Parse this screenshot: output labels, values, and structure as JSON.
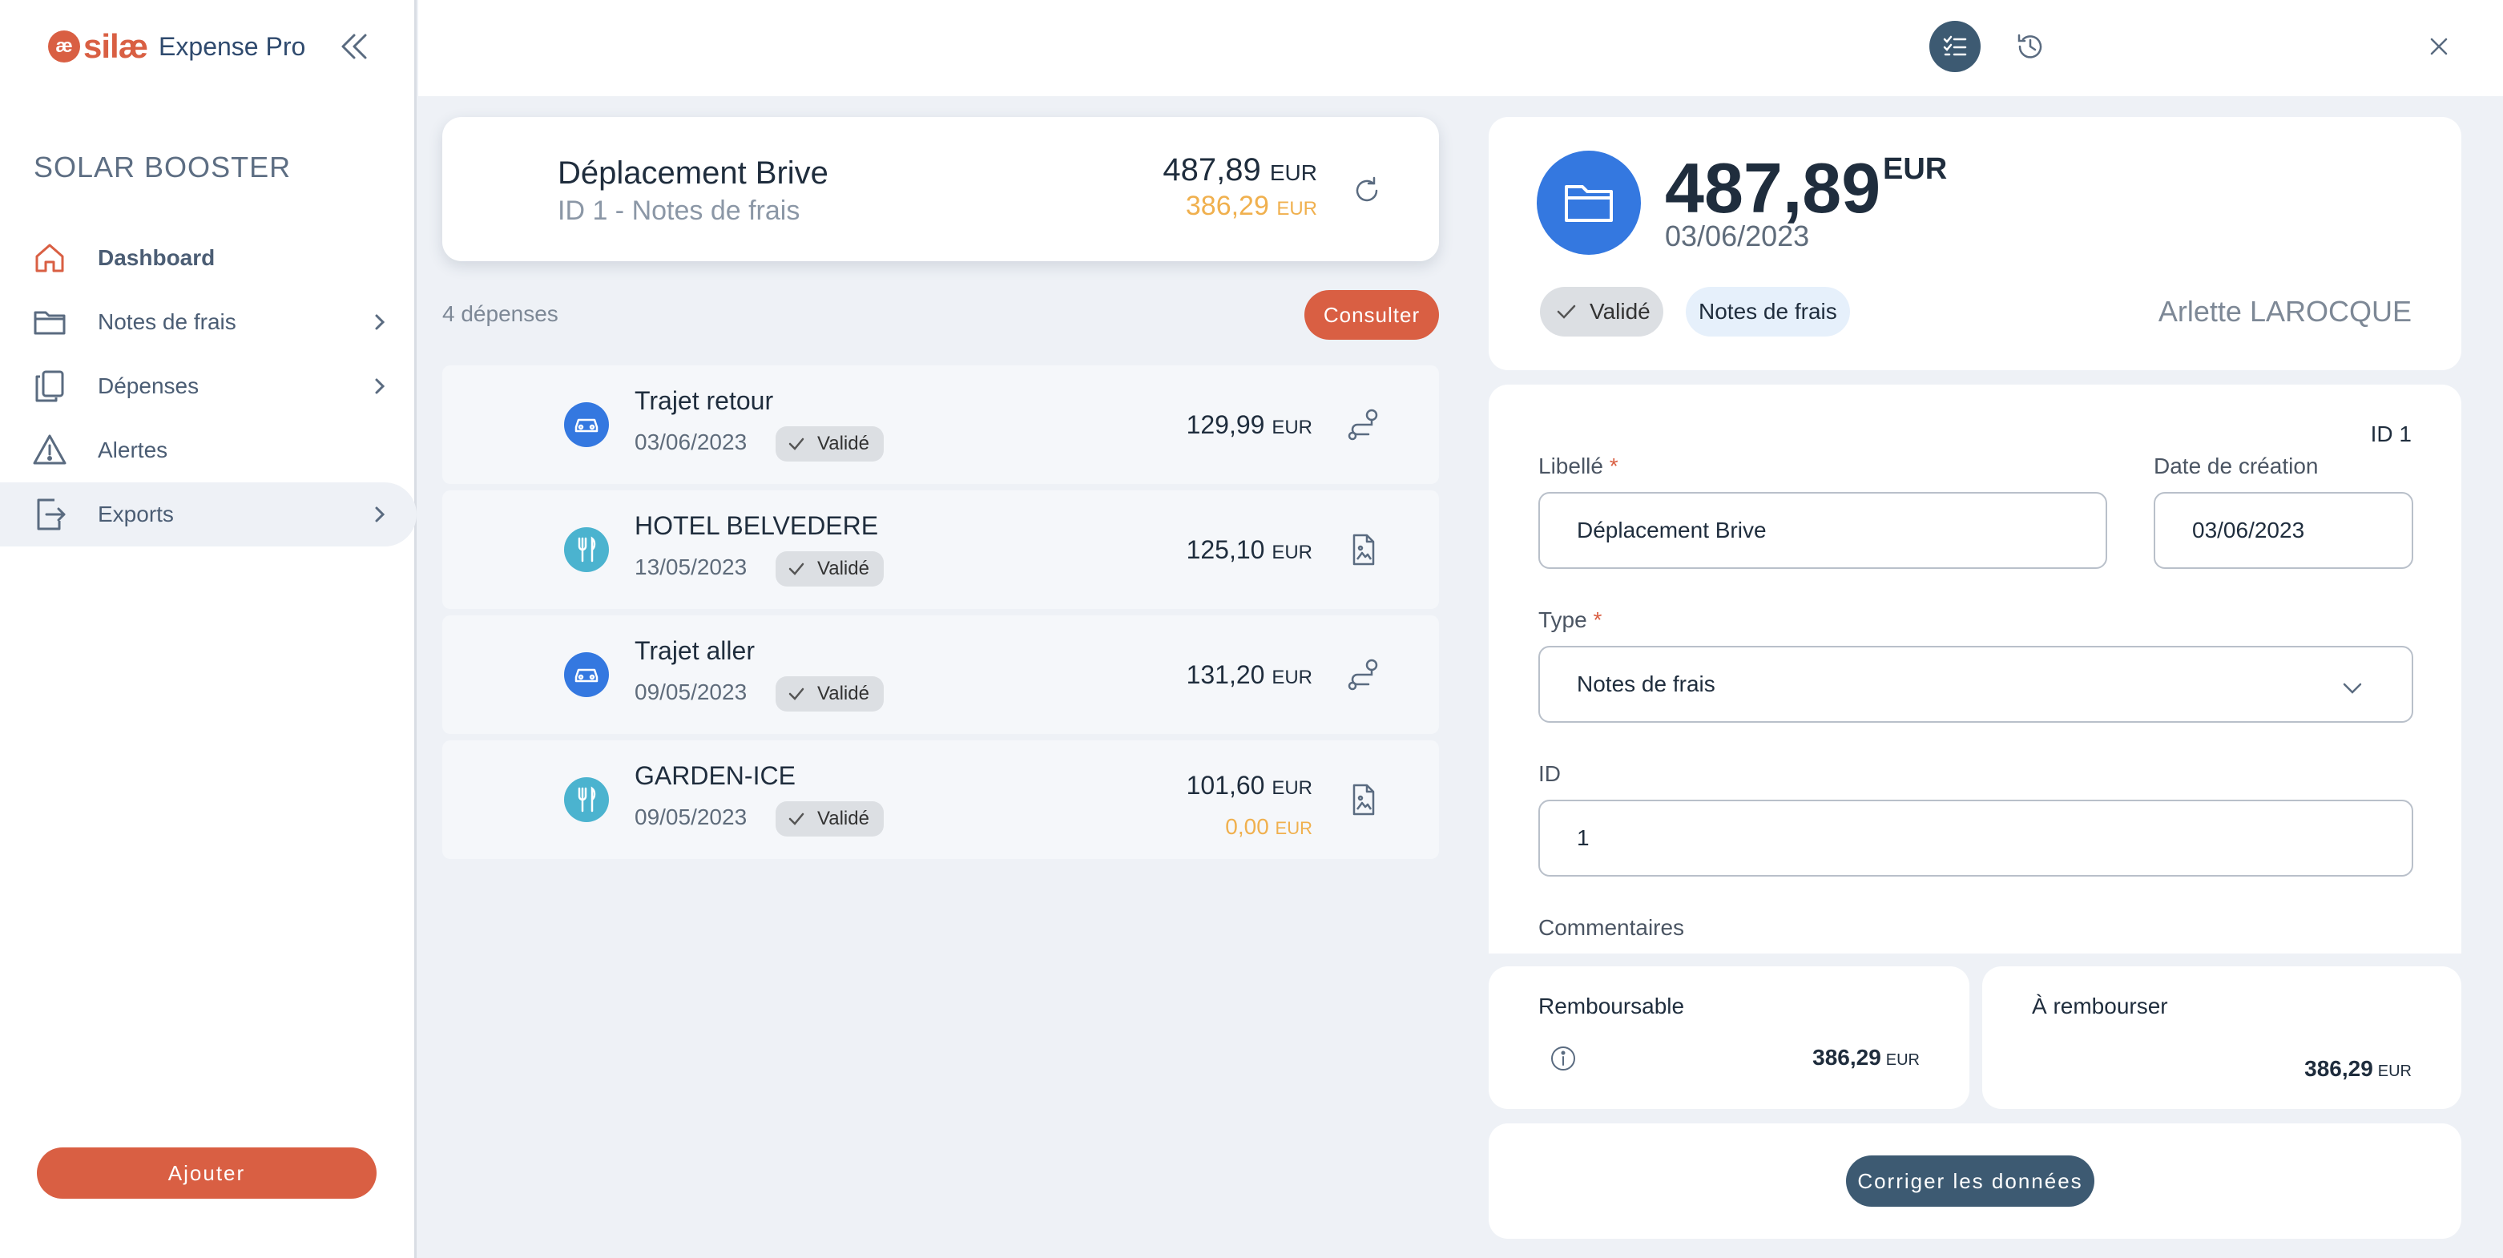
{
  "brand": {
    "mark": "æ",
    "silae": "silæ",
    "product": "Expense Pro"
  },
  "sidebar": {
    "company": "SOLAR BOOSTER",
    "items": [
      {
        "label": "Dashboard",
        "icon": "home-icon"
      },
      {
        "label": "Notes de frais",
        "icon": "folder-icon"
      },
      {
        "label": "Dépenses",
        "icon": "copy-icon"
      },
      {
        "label": "Alertes",
        "icon": "warning-icon"
      },
      {
        "label": "Exports",
        "icon": "export-icon"
      }
    ],
    "add_label": "Ajouter"
  },
  "report": {
    "title": "Déplacement Brive",
    "subtitle": "ID 1 - Notes de frais",
    "amount": "487,89",
    "amount_reimb": "386,29",
    "currency": "EUR"
  },
  "list": {
    "count": "4 dépenses",
    "consult_label": "Consulter",
    "expenses": [
      {
        "title": "Trajet retour",
        "date": "03/06/2023",
        "status": "Validé",
        "amount": "129,99",
        "currency": "EUR",
        "kind": "car",
        "action": "route-icon"
      },
      {
        "title": "HOTEL BELVEDERE",
        "date": "13/05/2023",
        "status": "Validé",
        "amount": "125,10",
        "currency": "EUR",
        "kind": "food",
        "action": "receipt-icon"
      },
      {
        "title": "Trajet aller",
        "date": "09/05/2023",
        "status": "Validé",
        "amount": "131,20",
        "currency": "EUR",
        "kind": "car",
        "action": "route-icon"
      },
      {
        "title": "GARDEN-ICE",
        "date": "09/05/2023",
        "status": "Validé",
        "amount": "101,60",
        "amount2": "0,00",
        "currency": "EUR",
        "kind": "food",
        "action": "receipt-icon"
      }
    ]
  },
  "detail": {
    "amount": "487,89",
    "currency": "EUR",
    "date": "03/06/2023",
    "status": "Validé",
    "type": "Notes de frais",
    "owner": "Arlette LAROCQUE",
    "id_tag": "ID 1",
    "form": {
      "libelle_label": "Libellé",
      "libelle_value": "Déplacement Brive",
      "date_label": "Date de création",
      "date_value": "03/06/2023",
      "type_label": "Type",
      "type_value": "Notes de frais",
      "id_label": "ID",
      "id_value": "1",
      "comments_label": "Commentaires",
      "required_mark": "*"
    },
    "remboursable_label": "Remboursable",
    "remboursable_value": "386,29",
    "a_rembourser_label": "À rembourser",
    "a_rembourser_value": "386,29",
    "fix_label": "Corriger les données"
  },
  "colors": {
    "accent": "#d95f43",
    "primary": "#3d5a72",
    "blue": "#3478e0",
    "teal": "#4bb3cf",
    "amber": "#f0b04e"
  }
}
